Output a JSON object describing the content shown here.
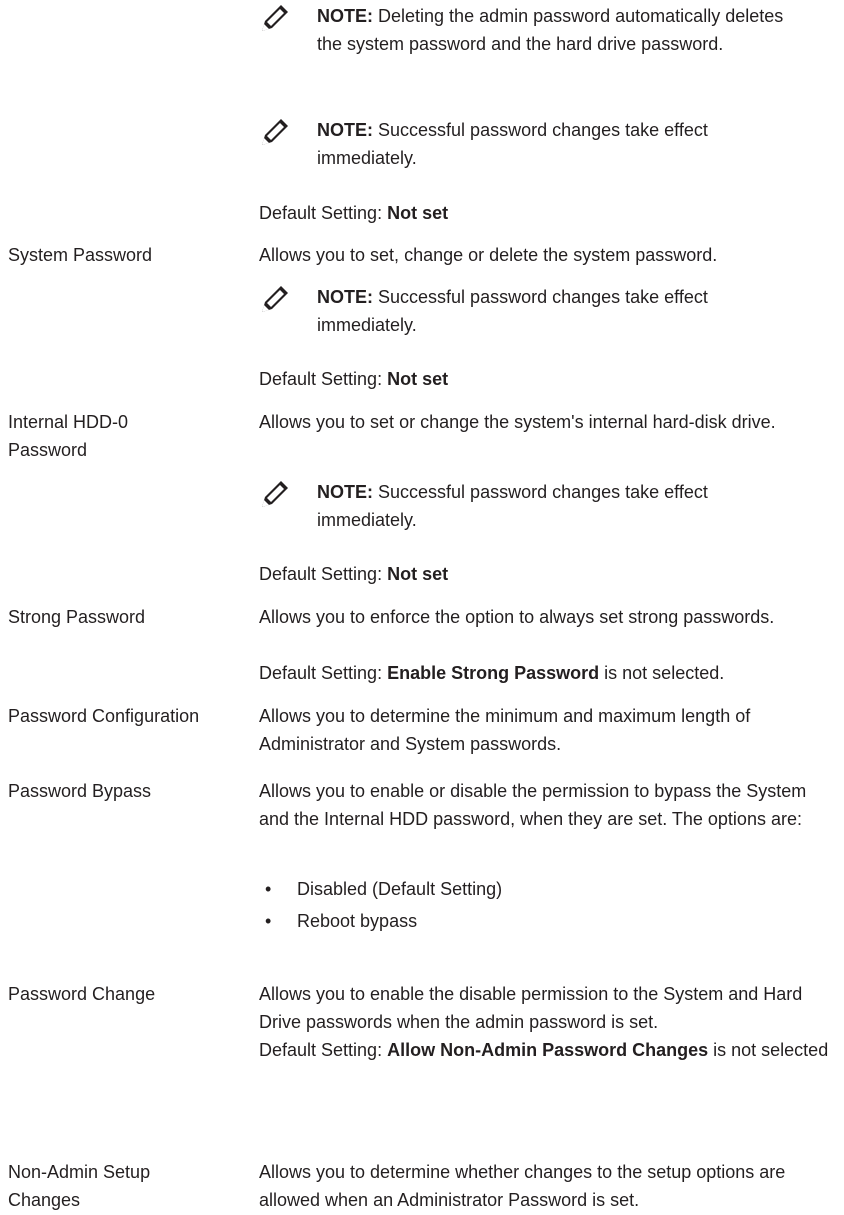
{
  "notes": {
    "label": "NOTE:",
    "admin_delete": "Deleting the admin password automatically deletes the system password and the hard drive password.",
    "success": "Successful password changes take effect immediately."
  },
  "default_prefix": "Default Setting:",
  "admin": {
    "default_value": "Not set"
  },
  "system_password": {
    "label": "System Password",
    "description": "Allows you to set, change or delete the system password.",
    "default_value": "Not set"
  },
  "internal_hdd": {
    "label": "Internal HDD-0 Password",
    "description": "Allows you to set or change the system's internal hard-disk drive.",
    "default_value": "Not set"
  },
  "strong_password": {
    "label": "Strong Password",
    "description": "Allows you to enforce the option to always set strong passwords.",
    "default_value": "Enable Strong Password",
    "default_suffix": "is not selected."
  },
  "password_configuration": {
    "label": "Password Configuration",
    "description": "Allows you to determine the minimum and maximum length of Administrator and System passwords."
  },
  "password_bypass": {
    "label": "Password Bypass",
    "description": "Allows you to enable or disable the permission to bypass the System and the Internal HDD password, when they are set. The options are:",
    "options": [
      "Disabled (Default Setting)",
      "Reboot bypass"
    ]
  },
  "password_change": {
    "label": "Password Change",
    "description": "Allows you to enable the disable permission to the System and Hard Drive passwords when the admin password is set.",
    "default_value": "Allow Non-Admin Password Changes",
    "default_suffix": "is not selected"
  },
  "non_admin_setup": {
    "label": "Non-Admin Setup Changes",
    "description": "Allows you to determine whether changes to the setup options are allowed when an Administrator Password is set."
  },
  "icons": {
    "note": "pencil-note-icon",
    "bullet": "bullet"
  }
}
